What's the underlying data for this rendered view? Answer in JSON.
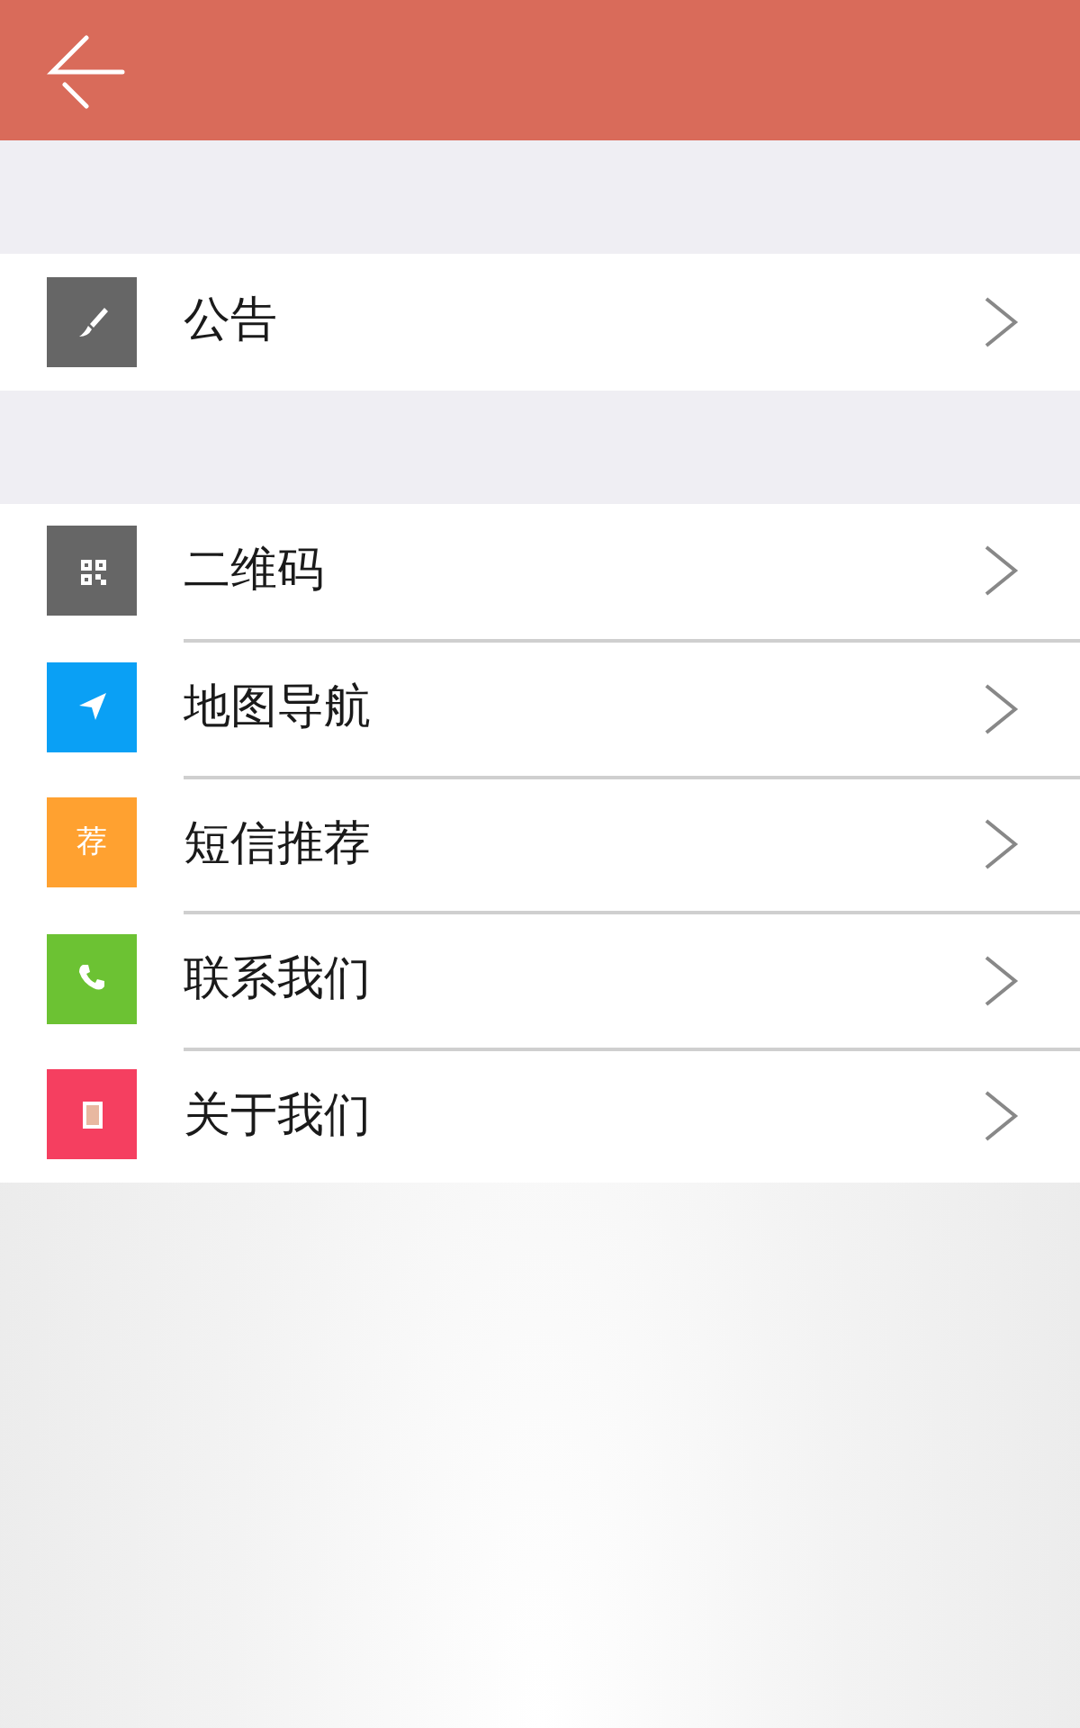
{
  "groups": [
    {
      "items": [
        {
          "label": "公告",
          "kind": "brush",
          "color": "#666666"
        }
      ]
    },
    {
      "items": [
        {
          "label": "二维码",
          "kind": "qr",
          "color": "#666666"
        },
        {
          "label": "地图导航",
          "kind": "navigate",
          "color": "#0aa0f5"
        },
        {
          "label": "短信推荐",
          "kind": "glyph",
          "icon_text": "荐",
          "color": "#ffa130"
        },
        {
          "label": "联系我们",
          "kind": "phone",
          "color": "#6cc233"
        },
        {
          "label": "关于我们",
          "kind": "doc",
          "color": "#f53f60"
        }
      ]
    }
  ]
}
